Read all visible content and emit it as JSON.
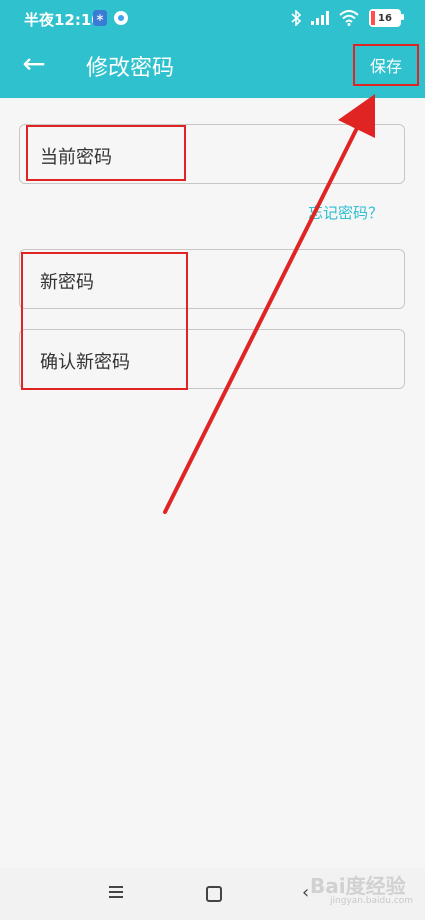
{
  "status_bar": {
    "time": "半夜12:10",
    "bt_badge": "∗",
    "battery": "16",
    "battery_level": 0.16
  },
  "app_bar": {
    "back_icon": "←",
    "title": "修改密码",
    "save_label": "保存"
  },
  "form": {
    "current_password": "当前密码",
    "forgot_password": "忘记密码？",
    "new_password": "新密码",
    "confirm_password": "确认新密码"
  },
  "nav_bar": {
    "back_icon": "‹"
  },
  "watermark": {
    "main": "Bai度经验",
    "sub": "jingyan.baidu.com"
  },
  "colors": {
    "accent": "#2fc2ce",
    "annotation": "#e02424",
    "link": "#2fbfd0"
  }
}
